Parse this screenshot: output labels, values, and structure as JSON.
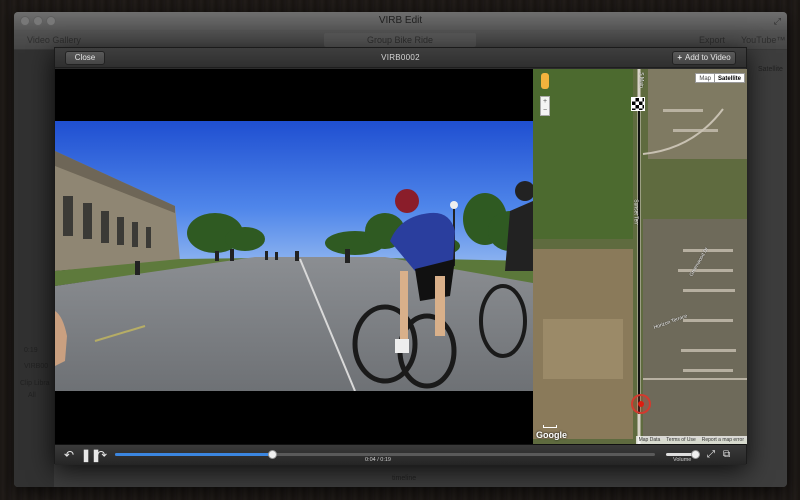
{
  "app": {
    "title": "VIRB Edit",
    "toolbar": {
      "video_gallery": "Video Gallery",
      "project_name": "Group Bike Ride",
      "export": "Export",
      "youtube": "YouTube™"
    },
    "sidebar_ghost": {
      "time": "0:19",
      "clip_name": "VIRB00",
      "clip_library": "Clip Libra",
      "all": "All",
      "timeline_label": "timeline",
      "satellite": "Satellite"
    }
  },
  "modal": {
    "close_label": "Close",
    "title": "VIRB0002",
    "add_label": "Add to Video"
  },
  "map": {
    "type_map": "Map",
    "type_satellite": "Satellite",
    "logo": "Google",
    "footer": [
      "Map Data",
      "Terms of Use",
      "Report a map error"
    ],
    "streets": [
      "S Main",
      "Sunset Terr",
      "Greenwood Dr",
      "Horizon Terrace"
    ]
  },
  "controls": {
    "time": "0:04 / 0:19",
    "volume_label": "Volume",
    "progress": 0.29,
    "volume": 0.85
  },
  "colors": {
    "accent": "#3b86e0",
    "marker": "#d23a2e"
  }
}
